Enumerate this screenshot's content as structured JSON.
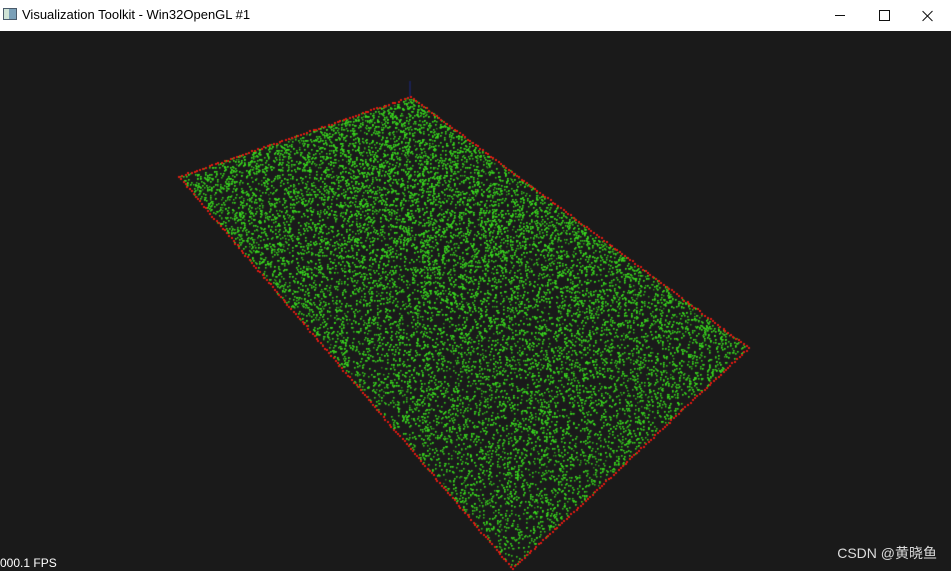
{
  "window": {
    "title": "Visualization Toolkit - Win32OpenGL #1",
    "icon": "vtk-app-icon",
    "controls": {
      "minimize": "minimize-icon",
      "maximize": "maximize-icon",
      "close": "close-icon"
    }
  },
  "viewport": {
    "background_color": "#1a1a1a",
    "fps_label": "000.1 FPS",
    "watermark": "CSDN @黄晓鱼",
    "point_cloud": {
      "point_color": "#39d81e",
      "boundary_color": "#e01a12",
      "axis_color": "#1a2a8a"
    }
  }
}
